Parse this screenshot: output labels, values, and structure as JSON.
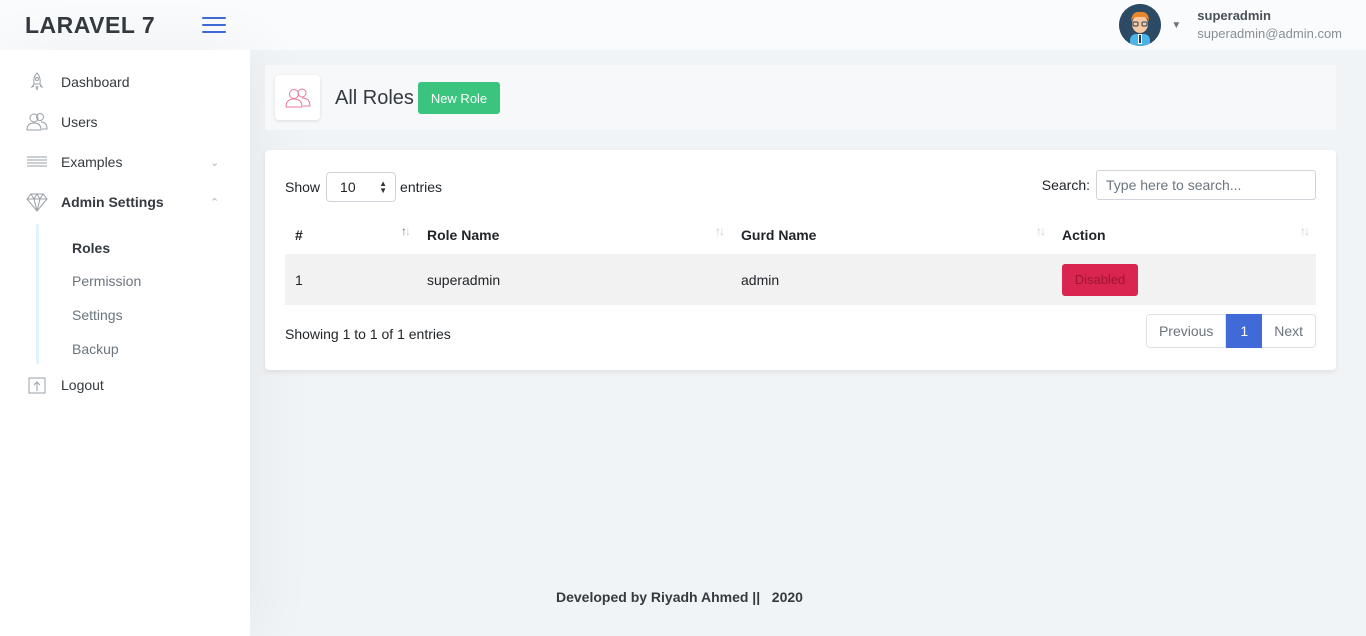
{
  "header": {
    "brand": "LARAVEL 7",
    "user_name": "superadmin",
    "user_email": "superadmin@admin.com"
  },
  "sidebar": {
    "items": [
      {
        "label": "Dashboard",
        "icon": "rocket-icon"
      },
      {
        "label": "Users",
        "icon": "users-icon"
      },
      {
        "label": "Examples",
        "icon": "menu-lines-icon"
      },
      {
        "label": "Admin Settings",
        "icon": "diamond-icon"
      },
      {
        "label": "Logout",
        "icon": "upload-icon"
      }
    ],
    "subitems": [
      "Roles",
      "Permission",
      "Settings",
      "Backup"
    ]
  },
  "page": {
    "title": "All Roles",
    "new_button": "New Role"
  },
  "table_controls": {
    "show_label": "Show",
    "entries_value": "10",
    "entries_label": "entries",
    "search_label": "Search:",
    "search_placeholder": "Type here to search..."
  },
  "table": {
    "headers": [
      "#",
      "Role Name",
      "Gurd Name",
      "Action"
    ],
    "rows": [
      {
        "id": "1",
        "role": "superadmin",
        "guard": "admin",
        "action": "Disabled"
      }
    ]
  },
  "pagination": {
    "info": "Showing 1 to 1 of 1 entries",
    "previous": "Previous",
    "current": "1",
    "next": "Next"
  },
  "footer": {
    "text": "Developed by Riyadh Ahmed ||   2020"
  },
  "colors": {
    "primary": "#3f6ad8",
    "success": "#3ac47d",
    "danger": "#d92550"
  }
}
